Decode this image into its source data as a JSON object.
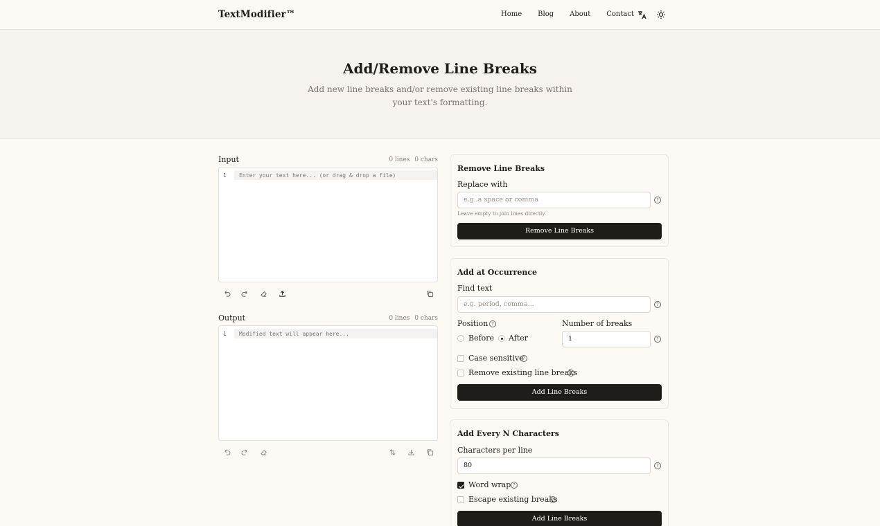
{
  "header": {
    "logo": "TextModifier™",
    "nav": [
      "Home",
      "Blog",
      "About",
      "Contact"
    ]
  },
  "hero": {
    "title": "Add/Remove Line Breaks",
    "subtitle": "Add new line breaks and/or remove existing line breaks within your text's formatting."
  },
  "input": {
    "label": "Input",
    "lines": "0 lines",
    "chars": "0 chars",
    "line_number": "1",
    "placeholder": "Enter your text here... (or drag & drop a file)"
  },
  "output": {
    "label": "Output",
    "lines": "0 lines",
    "chars": "0 chars",
    "line_number": "1",
    "placeholder": "Modified text will appear here..."
  },
  "remove_panel": {
    "title": "Remove Line Breaks",
    "replace_label": "Replace with",
    "replace_placeholder": "e.g. a space or comma",
    "hint": "Leave empty to join lines directly.",
    "button": "Remove Line Breaks"
  },
  "occurrence_panel": {
    "title": "Add at Occurrence",
    "find_label": "Find text",
    "find_placeholder": "e.g. period, comma...",
    "position_label": "Position",
    "before": "Before",
    "after": "After",
    "breaks_label": "Number of breaks",
    "breaks_value": "1",
    "case_sensitive": "Case sensitive",
    "remove_existing": "Remove existing line breaks",
    "button": "Add Line Breaks"
  },
  "every_panel": {
    "title": "Add Every N Characters",
    "chars_label": "Characters per line",
    "chars_value": "80",
    "word_wrap": "Word wrap",
    "escape_breaks": "Escape existing breaks",
    "button": "Add Line Breaks"
  },
  "icons": {
    "undo": "undo-icon",
    "redo": "redo-icon",
    "clear": "eraser-icon",
    "upload": "upload-icon",
    "copy": "copy-icon",
    "swap": "swap-icon",
    "download": "download-icon",
    "help": "help-circle-icon",
    "translate": "translate-icon",
    "theme": "sun-icon"
  }
}
